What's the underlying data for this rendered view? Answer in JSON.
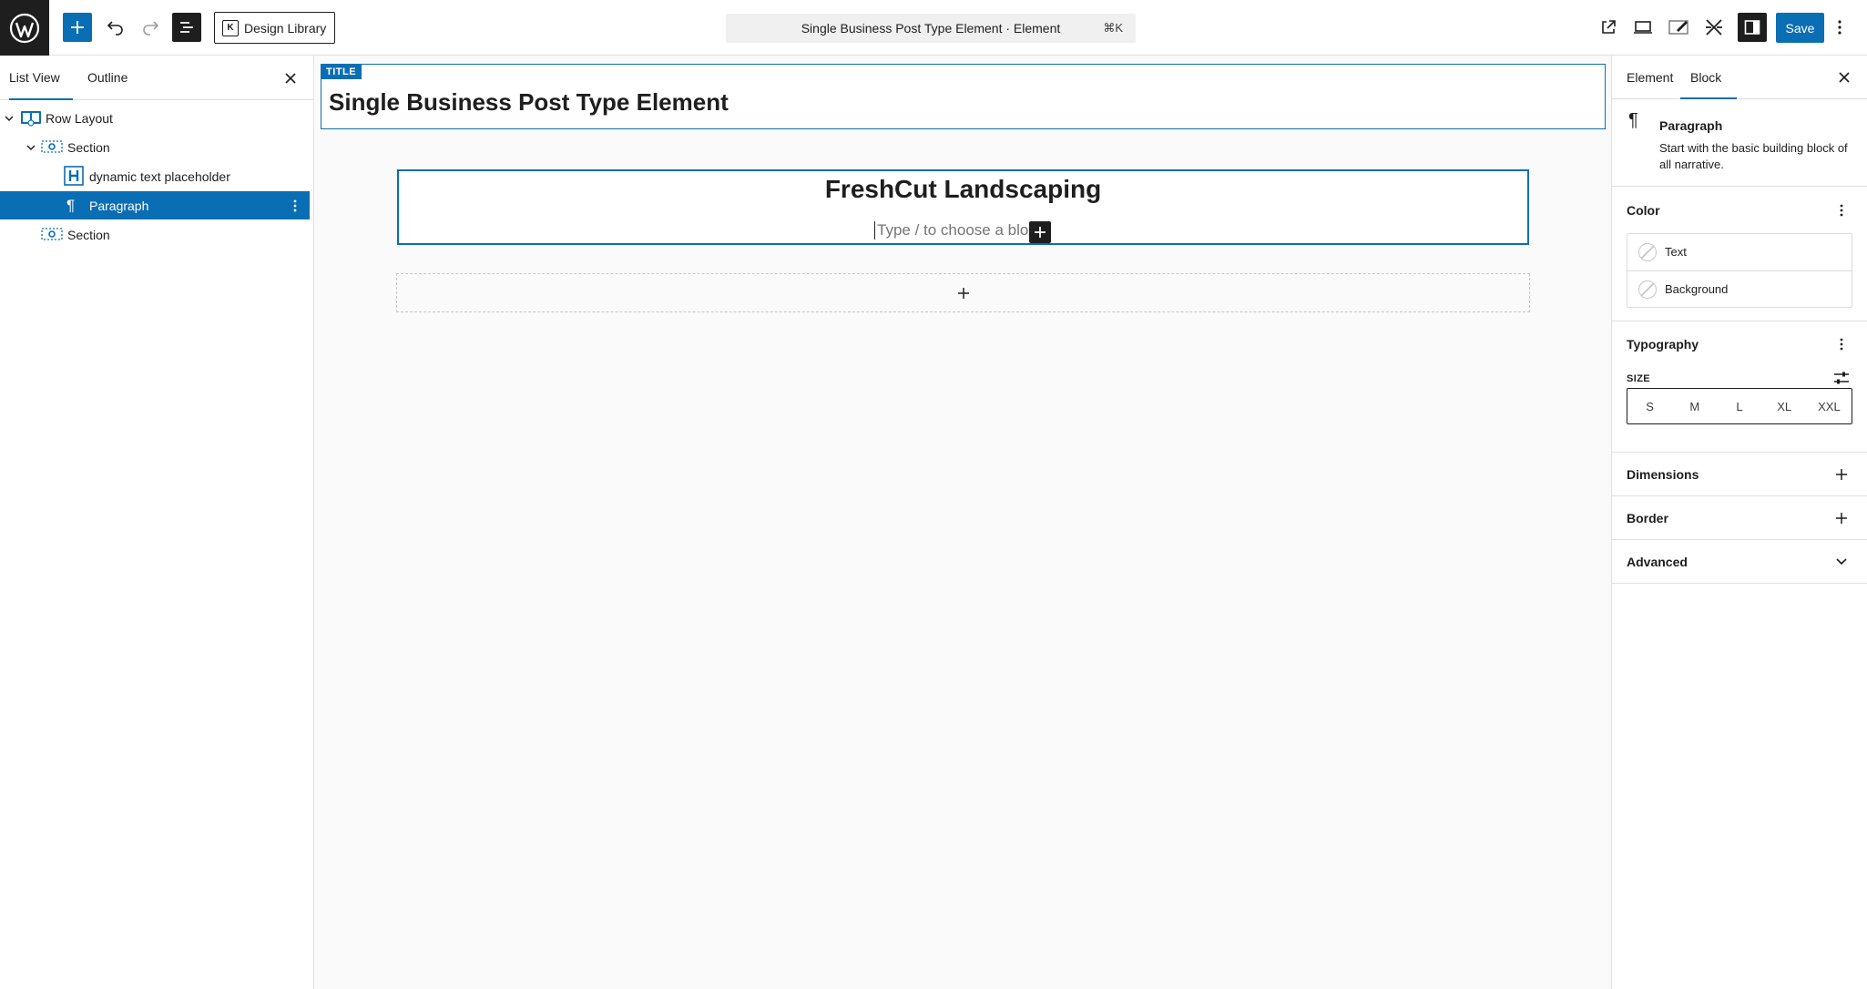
{
  "topbar": {
    "design_library_label": "Design Library",
    "command_text": "Single Business Post Type Element · Element",
    "command_shortcut": "⌘K",
    "save_label": "Save"
  },
  "left_panel": {
    "tabs": [
      "List View",
      "Outline"
    ],
    "tree": [
      {
        "label": "Row Layout",
        "icon": "row-layout-icon",
        "expanded": true
      },
      {
        "label": "Section",
        "icon": "section-icon",
        "expanded": true
      },
      {
        "label": "dynamic text placeholder",
        "icon": "heading-h-icon"
      },
      {
        "label": "Paragraph",
        "icon": "paragraph-icon",
        "selected": true
      },
      {
        "label": "Section",
        "icon": "section-icon"
      }
    ]
  },
  "canvas": {
    "title_tag": "TITLE",
    "title": "Single Business Post Type Element",
    "heading": "FreshCut Landscaping",
    "paragraph_placeholder": "Type / to choose a blo"
  },
  "right_panel": {
    "tabs": [
      "Element",
      "Block"
    ],
    "active_tab": "Block",
    "block_card": {
      "title": "Paragraph",
      "description": "Start with the basic building block of all narrative."
    },
    "color": {
      "title": "Color",
      "items": [
        "Text",
        "Background"
      ]
    },
    "typography": {
      "title": "Typography",
      "size_label": "SIZE",
      "sizes": [
        "S",
        "M",
        "L",
        "XL",
        "XXL"
      ]
    },
    "dimensions": {
      "title": "Dimensions"
    },
    "border": {
      "title": "Border"
    },
    "advanced": {
      "title": "Advanced"
    }
  },
  "colors": {
    "accent": "#0a6eb4",
    "dark": "#1e1e1e",
    "canvas_bg": "#fafafa"
  }
}
